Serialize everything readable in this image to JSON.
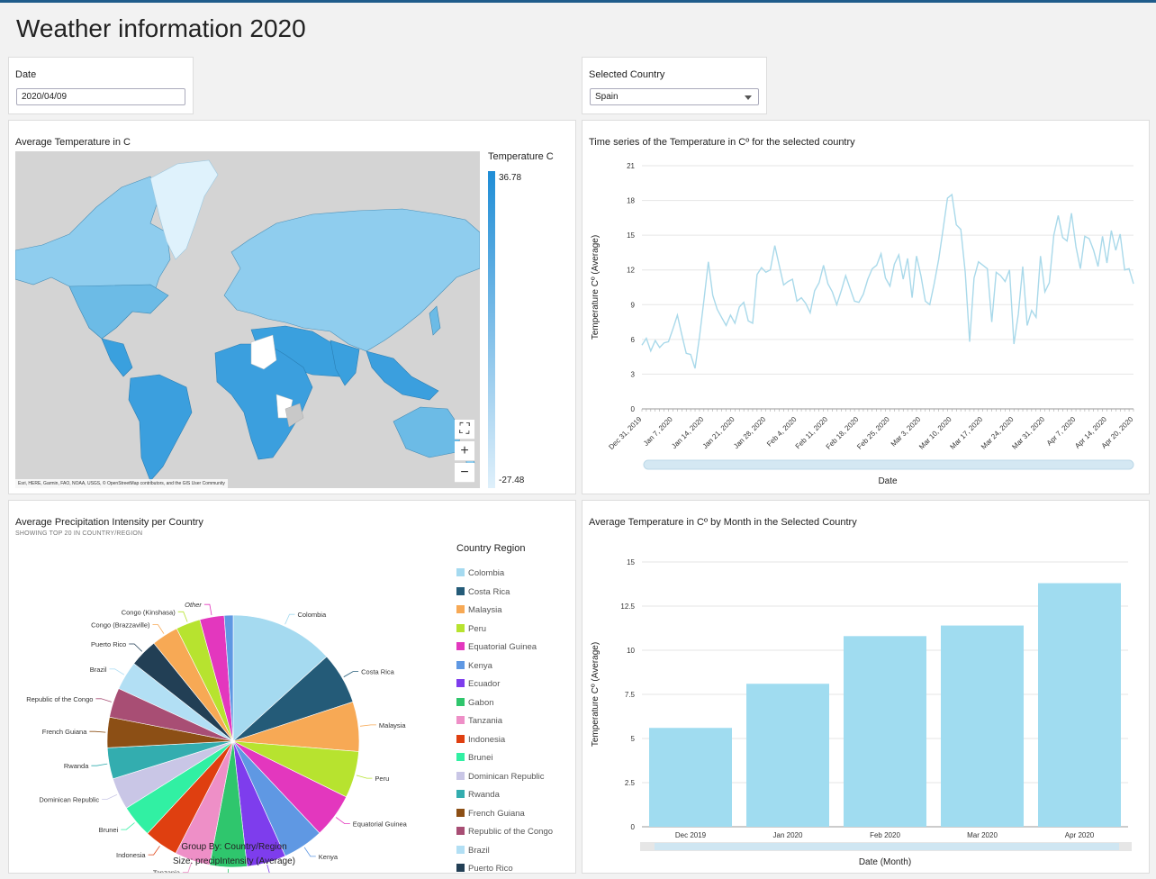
{
  "page": {
    "title": "Weather information 2020"
  },
  "date_control": {
    "label": "Date",
    "value": "2020/04/09"
  },
  "country_control": {
    "label": "Selected Country",
    "value": "Spain"
  },
  "map": {
    "title": "Average Temperature in C",
    "legend_title": "Temperature C",
    "legend_max": "36.78",
    "legend_min": "-27.48",
    "attribution": "Esri, HERE, Garmin, FAO, NOAA, USGS, © OpenStreetMap contributors, and the GIS User Community",
    "zoom_in": "+",
    "zoom_out": "−",
    "gradient_colors": [
      "#1f8dd6",
      "#dff0fb"
    ],
    "ocean_color": "#d4d4d4",
    "fit_icon": "fit-extent-icon"
  },
  "timeseries": {
    "title": "Time series of the Temperature in Cº for the selected country",
    "xlabel": "Date",
    "ylabel": "Temperature Cº (Average)",
    "color": "#a9d9ea",
    "xticks": [
      "Dec 31, 2019",
      "Jan 7, 2020",
      "Jan 14, 2020",
      "Jan 21, 2020",
      "Jan 28, 2020",
      "Feb 4, 2020",
      "Feb 11, 2020",
      "Feb 18, 2020",
      "Feb 25, 2020",
      "Mar 3, 2020",
      "Mar 10, 2020",
      "Mar 17, 2020",
      "Mar 24, 2020",
      "Mar 31, 2020",
      "Apr 7, 2020",
      "Apr 14, 2020",
      "Apr 20, 2020"
    ]
  },
  "pie": {
    "title": "Average Precipitation Intensity per Country",
    "subtitle": "SHOWING TOP 20 IN COUNTRY/REGION",
    "legend_title": "Country Region",
    "group_by": "Group By: Country/Region",
    "size_by": "Size: precipIntensity (Average)"
  },
  "bar": {
    "title": "Average Temperature in Cº by Month in the Selected Country",
    "xlabel": "Date (Month)",
    "ylabel": "Temperature Cº (Average)",
    "color": "#a0dcf0"
  },
  "chart_data": [
    {
      "type": "line",
      "title": "Time series of the Temperature in Cº for the selected country",
      "xlabel": "Date",
      "ylabel": "Temperature Cº (Average)",
      "ylim": [
        0,
        21
      ],
      "yticks": [
        0,
        3,
        6,
        9,
        12,
        15,
        18,
        21
      ],
      "xlim": [
        "2019-12-31",
        "2020-04-21"
      ],
      "series": [
        {
          "x_start": "2019-12-31",
          "x_step_days": 1,
          "values": [
            5.5,
            6.1,
            5.0,
            5.9,
            5.3,
            5.7,
            5.8,
            6.9,
            8.1,
            6.4,
            4.8,
            4.7,
            3.5,
            6.2,
            9.4,
            12.7,
            9.8,
            8.6,
            7.9,
            7.2,
            8.1,
            7.4,
            8.8,
            9.2,
            7.6,
            7.4,
            11.6,
            12.2,
            11.8,
            12.0,
            14.1,
            12.4,
            10.7,
            11.0,
            11.2,
            9.3,
            9.6,
            9.1,
            8.3,
            10.2,
            10.9,
            12.4,
            10.8,
            10.1,
            9.0,
            10.2,
            11.5,
            10.4,
            9.3,
            9.2,
            9.9,
            11.2,
            12.1,
            12.4,
            13.4,
            11.3,
            10.6,
            12.5,
            13.3,
            11.2,
            13.0,
            9.6,
            13.2,
            11.5,
            9.3,
            9.0,
            10.8,
            12.9,
            15.5,
            18.2,
            18.5,
            15.9,
            15.5,
            11.8,
            5.8,
            11.3,
            12.7,
            12.4,
            12.1,
            7.5,
            11.8,
            11.5,
            11.0,
            12.0,
            5.6,
            8.2,
            12.3,
            7.2,
            8.5,
            7.9,
            13.2,
            10.1,
            10.9,
            15.0,
            16.7,
            14.8,
            14.5,
            16.9,
            14.0,
            12.1,
            14.9,
            14.7,
            13.7,
            12.3,
            14.9,
            12.6,
            15.4,
            13.7,
            15.1,
            12.0,
            12.1,
            10.8
          ]
        }
      ]
    },
    {
      "type": "pie",
      "title": "Average Precipitation Intensity per Country",
      "subtitle": "SHOWING TOP 20 IN COUNTRY/REGION",
      "group_by": "Country/Region",
      "size_by": "precipIntensity (Average)",
      "slices": [
        {
          "label": "Colombia",
          "value": 0.14,
          "color": "#a5daf0"
        },
        {
          "label": "Costa Rica",
          "value": 0.07,
          "color": "#245b78"
        },
        {
          "label": "Malaysia",
          "value": 0.067,
          "color": "#f7a955"
        },
        {
          "label": "Peru",
          "value": 0.063,
          "color": "#b7e32f"
        },
        {
          "label": "Equatorial Guinea",
          "value": 0.06,
          "color": "#e337be"
        },
        {
          "label": "Kenya",
          "value": 0.055,
          "color": "#5f98e3"
        },
        {
          "label": "Ecuador",
          "value": 0.053,
          "color": "#7e3ded"
        },
        {
          "label": "Gabon",
          "value": 0.05,
          "color": "#2fc66d"
        },
        {
          "label": "Tanzania",
          "value": 0.048,
          "color": "#ee8fc7"
        },
        {
          "label": "Indonesia",
          "value": 0.046,
          "color": "#df3f10"
        },
        {
          "label": "Brunei",
          "value": 0.044,
          "color": "#31f0a3"
        },
        {
          "label": "Dominican Republic",
          "value": 0.043,
          "color": "#c9c6e6"
        },
        {
          "label": "Rwanda",
          "value": 0.042,
          "color": "#33adaf"
        },
        {
          "label": "French Guiana",
          "value": 0.041,
          "color": "#8c4f15"
        },
        {
          "label": "Republic of the Congo",
          "value": 0.04,
          "color": "#a84e74"
        },
        {
          "label": "Brazil",
          "value": 0.039,
          "color": "#b2dff4"
        },
        {
          "label": "Puerto Rico",
          "value": 0.038,
          "color": "#223f55"
        },
        {
          "label": "Congo (Brazzaville)",
          "value": 0.036,
          "color": "#f7a955"
        },
        {
          "label": "Congo (Kinshasa)",
          "value": 0.033,
          "color": "#b7e32f"
        },
        {
          "label": "Other",
          "value": 0.033,
          "color": "#e337be"
        },
        {
          "label": "",
          "value": 0.012,
          "color": "#5f98e3"
        }
      ]
    },
    {
      "type": "bar",
      "title": "Average Temperature in Cº by Month in the Selected Country",
      "xlabel": "Date (Month)",
      "ylabel": "Temperature Cº (Average)",
      "categories": [
        "Dec 2019",
        "Jan 2020",
        "Feb 2020",
        "Mar 2020",
        "Apr 2020"
      ],
      "values": [
        5.6,
        8.1,
        10.8,
        11.4,
        13.8
      ],
      "ylim": [
        0,
        15
      ],
      "yticks": [
        "0",
        "2.5",
        "5",
        "7.5",
        "10",
        "12.5",
        "15"
      ]
    }
  ],
  "pie_legend": [
    {
      "label": "Colombia",
      "color": "#a5daf0"
    },
    {
      "label": "Costa Rica",
      "color": "#245b78"
    },
    {
      "label": "Malaysia",
      "color": "#f7a955"
    },
    {
      "label": "Peru",
      "color": "#b7e32f"
    },
    {
      "label": "Equatorial Guinea",
      "color": "#e337be"
    },
    {
      "label": "Kenya",
      "color": "#5f98e3"
    },
    {
      "label": "Ecuador",
      "color": "#7e3ded"
    },
    {
      "label": "Gabon",
      "color": "#2fc66d"
    },
    {
      "label": "Tanzania",
      "color": "#ee8fc7"
    },
    {
      "label": "Indonesia",
      "color": "#df3f10"
    },
    {
      "label": "Brunei",
      "color": "#31f0a3"
    },
    {
      "label": "Dominican Republic",
      "color": "#c9c6e6"
    },
    {
      "label": "Rwanda",
      "color": "#33adaf"
    },
    {
      "label": "French Guiana",
      "color": "#8c4f15"
    },
    {
      "label": "Republic of the Congo",
      "color": "#a84e74"
    },
    {
      "label": "Brazil",
      "color": "#b2dff4"
    },
    {
      "label": "Puerto Rico",
      "color": "#223f55"
    }
  ]
}
